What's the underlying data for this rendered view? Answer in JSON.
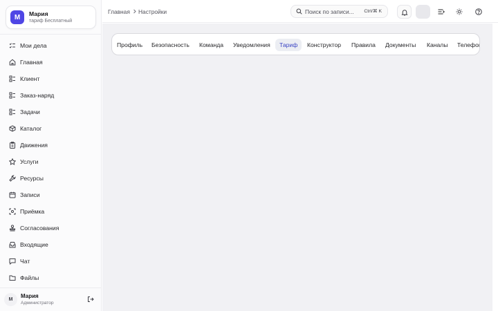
{
  "account": {
    "avatar_letter": "М",
    "name": "Мария",
    "plan": "тариф Бесплатный"
  },
  "sidebar": {
    "items": [
      {
        "label": "Мои дела",
        "icon": "checklist-icon"
      },
      {
        "label": "Главная",
        "icon": "home-icon"
      },
      {
        "label": "Клиент",
        "icon": "list-icon"
      },
      {
        "label": "Заказ-наряд",
        "icon": "list-icon"
      },
      {
        "label": "Задачи",
        "icon": "list-icon"
      },
      {
        "label": "Каталог",
        "icon": "box-icon"
      },
      {
        "label": "Движения",
        "icon": "clipboard-icon"
      },
      {
        "label": "Услуги",
        "icon": "star-icon"
      },
      {
        "label": "Ресурсы",
        "icon": "wrench-icon"
      },
      {
        "label": "Записи",
        "icon": "calendar-icon"
      },
      {
        "label": "Приёмка",
        "icon": "scan-icon"
      },
      {
        "label": "Согласования",
        "icon": "stamp-icon"
      },
      {
        "label": "Входящие",
        "icon": "inbox-icon"
      },
      {
        "label": "Чат",
        "icon": "chat-icon"
      },
      {
        "label": "Файлы",
        "icon": "folder-icon"
      }
    ]
  },
  "user": {
    "avatar_letter": "М",
    "name": "Мария",
    "role": "Администратор"
  },
  "header": {
    "breadcrumb": [
      "Главная",
      "Настройки"
    ],
    "search_text": "Поиск по записи...",
    "search_hint": "Ctrl/⌘ K"
  },
  "tabs": [
    {
      "label": "Профиль"
    },
    {
      "label": "Безопасность"
    },
    {
      "label": "Команда"
    },
    {
      "label": "Уведомления"
    },
    {
      "label": "Тариф",
      "active": true
    },
    {
      "label": "Конструктор"
    },
    {
      "label": "Правила"
    },
    {
      "label": "Документы"
    },
    {
      "label": "Каналы"
    },
    {
      "label": "Телефония"
    }
  ],
  "colors": {
    "accent": "#4f46e5",
    "active_tab_text": "#3b45c4",
    "main_bg": "#f1f1f4"
  }
}
